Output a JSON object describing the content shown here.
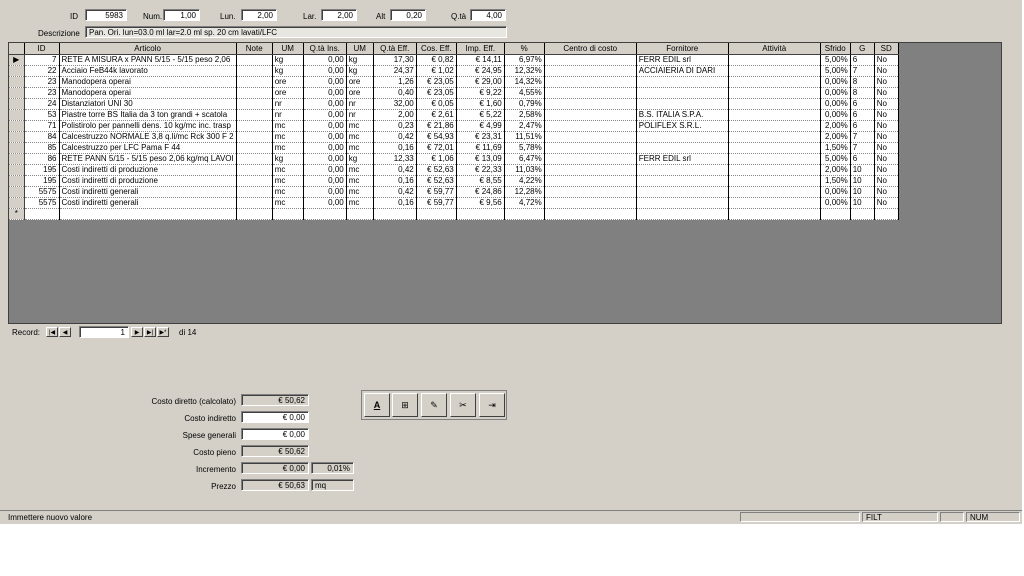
{
  "header": {
    "id_label": "ID",
    "id_value": "5983",
    "num_label": "Num.",
    "num_value": "1,00",
    "lun_label": "Lun.",
    "lun_value": "2,00",
    "lar_label": "Lar.",
    "lar_value": "2,00",
    "alt_label": "Alt",
    "alt_value": "0,20",
    "qta_label": "Q.tà",
    "qta_value": "4,00",
    "descrizione_label": "Descrizione",
    "descrizione_value": "Pan. Ori. lun=03.0 ml lar=2.0 ml sp. 20 cm lavati/LFC"
  },
  "grid": {
    "columns": [
      "ID",
      "Articolo",
      "Note",
      "UM",
      "Q.tà Ins.",
      "UM",
      "Q.tà Eff.",
      "Cos. Eff.",
      "Imp. Eff.",
      "%",
      "Centro di costo",
      "Fornitore",
      "Attività",
      "Sfrido",
      "G",
      "SD"
    ],
    "rows": [
      [
        "7",
        "RETE A MISURA x PANN 5/15 - 5/15 peso 2,06",
        "",
        "kg",
        "0,00",
        "kg",
        "17,30",
        "€ 0,82",
        "€ 14,11",
        "6,97%",
        "",
        "FERR EDIL srl",
        "",
        "5,00%",
        "6",
        "No"
      ],
      [
        "22",
        "Acciaio FeB44k lavorato",
        "",
        "kg",
        "0,00",
        "kg",
        "24,37",
        "€ 1,02",
        "€ 24,95",
        "12,32%",
        "",
        "ACCIAIERIA DI DARI",
        "",
        "5,00%",
        "7",
        "No"
      ],
      [
        "23",
        "Manodopera operai",
        "",
        "ore",
        "0,00",
        "ore",
        "1,26",
        "€ 23,05",
        "€ 29,00",
        "14,32%",
        "",
        "",
        "",
        "0,00%",
        "8",
        "No"
      ],
      [
        "23",
        "Manodopera operai",
        "",
        "ore",
        "0,00",
        "ore",
        "0,40",
        "€ 23,05",
        "€ 9,22",
        "4,55%",
        "",
        "",
        "",
        "0,00%",
        "8",
        "No"
      ],
      [
        "24",
        "Distanziatori UNI 30",
        "",
        "nr",
        "0,00",
        "nr",
        "32,00",
        "€ 0,05",
        "€ 1,60",
        "0,79%",
        "",
        "",
        "",
        "0,00%",
        "6",
        "No"
      ],
      [
        "53",
        "Piastre torre BS Italia da 3 ton grandi + scatola",
        "",
        "nr",
        "0,00",
        "nr",
        "2,00",
        "€ 2,61",
        "€ 5,22",
        "2,58%",
        "",
        "B.S. ITALIA S.P.A.",
        "",
        "0,00%",
        "6",
        "No"
      ],
      [
        "71",
        "Polistirolo per pannelli dens. 10 kg/mc inc. trasp",
        "",
        "mc",
        "0,00",
        "mc",
        "0,23",
        "€ 21,86",
        "€ 4,99",
        "2,47%",
        "",
        "POLIFLEX S.R.L.",
        "",
        "2,00%",
        "6",
        "No"
      ],
      [
        "84",
        "Calcestruzzo NORMALE 3,8 q.li/mc Rck 300 F 2",
        "",
        "mc",
        "0,00",
        "mc",
        "0,42",
        "€ 54,93",
        "€ 23,31",
        "11,51%",
        "",
        "",
        "",
        "2,00%",
        "7",
        "No"
      ],
      [
        "85",
        "Calcestruzzo per LFC Pama F 44",
        "",
        "mc",
        "0,00",
        "mc",
        "0,16",
        "€ 72,01",
        "€ 11,69",
        "5,78%",
        "",
        "",
        "",
        "1,50%",
        "7",
        "No"
      ],
      [
        "86",
        "RETE PANN 5/15 - 5/15 peso 2,06 kg/mq LAVOI",
        "",
        "kg",
        "0,00",
        "kg",
        "12,33",
        "€ 1,06",
        "€ 13,09",
        "6,47%",
        "",
        "FERR EDIL srl",
        "",
        "5,00%",
        "6",
        "No"
      ],
      [
        "195",
        "Costi indiretti di produzione",
        "",
        "mc",
        "0,00",
        "mc",
        "0,42",
        "€ 52,63",
        "€ 22,33",
        "11,03%",
        "",
        "",
        "",
        "2,00%",
        "10",
        "No"
      ],
      [
        "195",
        "Costi indiretti di produzione",
        "",
        "mc",
        "0,00",
        "mc",
        "0,16",
        "€ 52,63",
        "€ 8,55",
        "4,22%",
        "",
        "",
        "",
        "1,50%",
        "10",
        "No"
      ],
      [
        "5575",
        "Costi indiretti generali",
        "",
        "mc",
        "0,00",
        "mc",
        "0,42",
        "€ 59,77",
        "€ 24,86",
        "12,28%",
        "",
        "",
        "",
        "0,00%",
        "10",
        "No"
      ],
      [
        "5575",
        "Costi indiretti generali",
        "",
        "mc",
        "0,00",
        "mc",
        "0,16",
        "€ 59,77",
        "€ 9,56",
        "4,72%",
        "",
        "",
        "",
        "0,00%",
        "10",
        "No"
      ]
    ],
    "current_marker": "▶",
    "new_marker": "*"
  },
  "nav": {
    "record_label": "Record:",
    "current": "1",
    "of_label": "di 14",
    "first": "|◀",
    "prev": "◀",
    "next": "▶",
    "last": "▶|",
    "new": "▶*"
  },
  "totals": {
    "costo_diretto_label": "Costo diretto (calcolato)",
    "costo_diretto_value": "€ 50,62",
    "costo_indiretto_label": "Costo indiretto",
    "costo_indiretto_value": "€ 0,00",
    "spese_generali_label": "Spese generali",
    "spese_generali_value": "€ 0,00",
    "costo_pieno_label": "Costo pieno",
    "costo_pieno_value": "€ 50,62",
    "incremento_label": "Incremento",
    "incremento_value": "€ 0,00",
    "incremento_pct": "0,01%",
    "prezzo_label": "Prezzo",
    "prezzo_value": "€ 50,63",
    "prezzo_um": "mq"
  },
  "toolbar": {
    "icons": [
      "font-icon",
      "new-record-icon",
      "edit-icon",
      "tools-icon",
      "exit-icon"
    ],
    "glyphs": [
      "A",
      "⊞",
      "✎",
      "✂",
      "⇥"
    ]
  },
  "status": {
    "message": "Immettere nuovo valore",
    "filt": "FILT",
    "num": "NUM"
  }
}
